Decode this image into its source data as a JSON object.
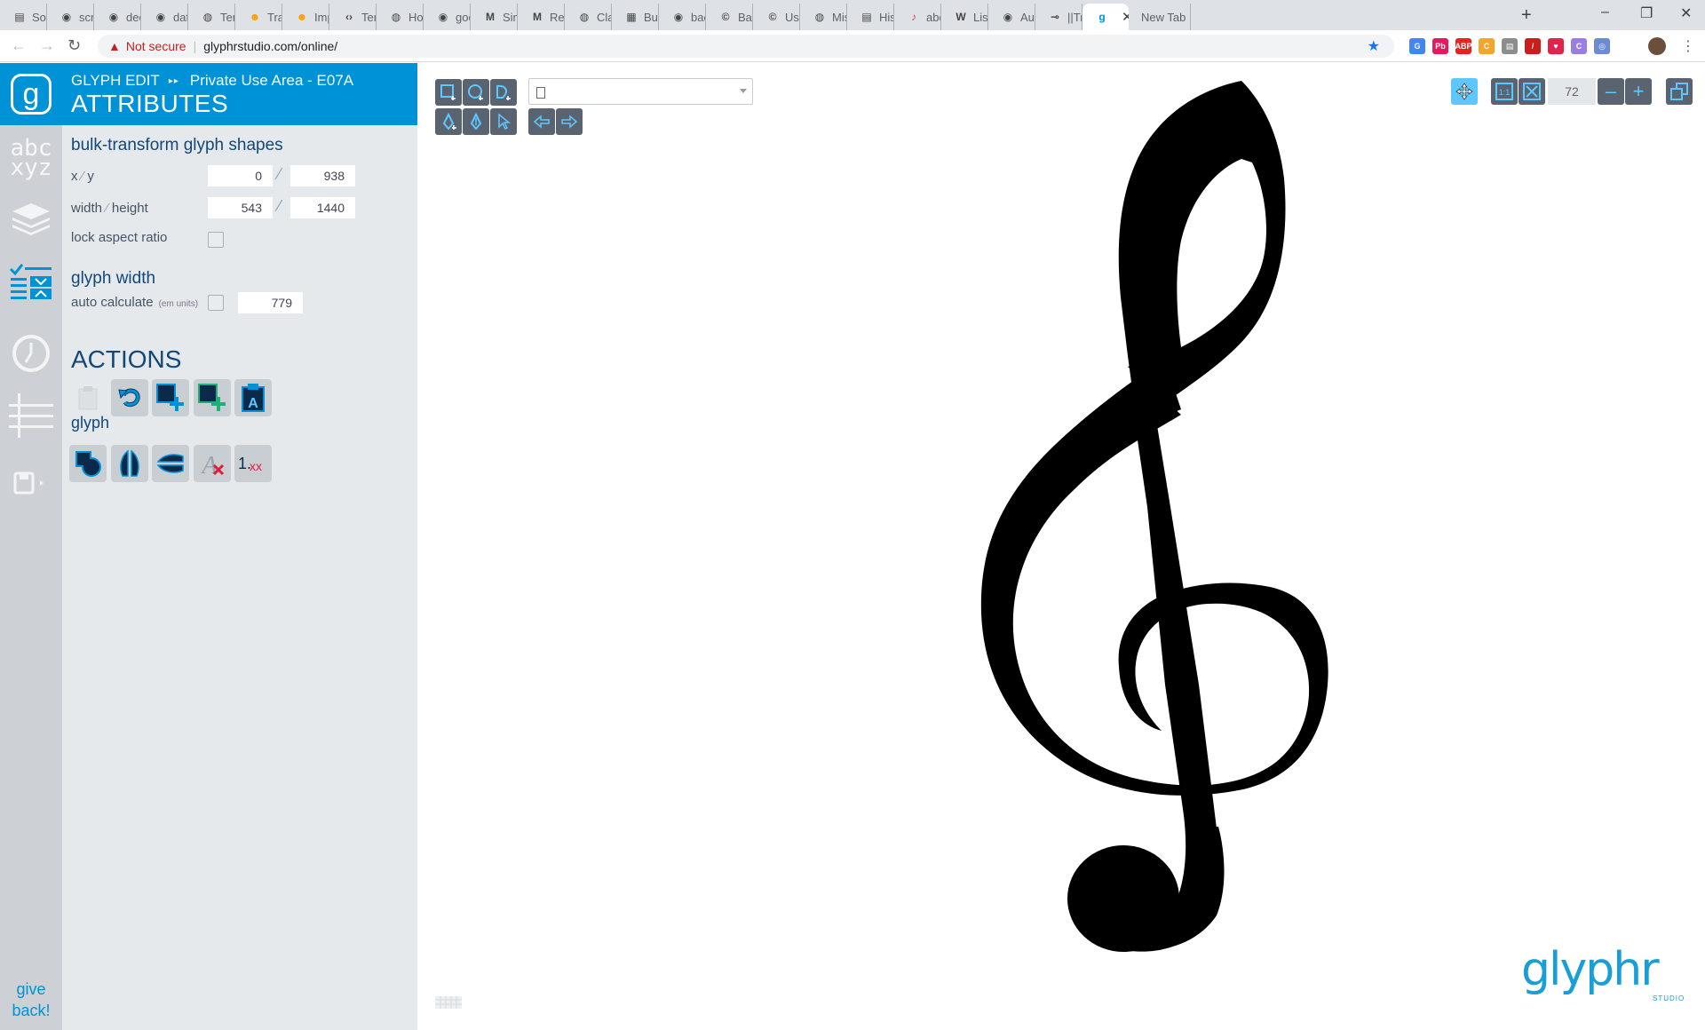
{
  "browser": {
    "tabs": [
      {
        "title": "Solid",
        "icon": "document-icon"
      },
      {
        "title": "scrap",
        "icon": "github-icon"
      },
      {
        "title": "deep",
        "icon": "github-icon"
      },
      {
        "title": "data-",
        "icon": "github-icon"
      },
      {
        "title": "Tenso",
        "icon": "globe-icon"
      },
      {
        "title": "Trans",
        "icon": "hugging-face-icon"
      },
      {
        "title": "Impo",
        "icon": "hugging-face-icon"
      },
      {
        "title": "Tenso",
        "icon": "code-icon"
      },
      {
        "title": "How",
        "icon": "globe-icon"
      },
      {
        "title": "goog",
        "icon": "github-icon"
      },
      {
        "title": "Simp",
        "icon": "medium-icon"
      },
      {
        "title": "Realt",
        "icon": "medium-icon"
      },
      {
        "title": "Class",
        "icon": "globe-icon"
      },
      {
        "title": "Build",
        "icon": "film-icon"
      },
      {
        "title": "bacti",
        "icon": "github-icon"
      },
      {
        "title": "Basic",
        "icon": "circle-c-icon"
      },
      {
        "title": "Using",
        "icon": "circle-c-icon"
      },
      {
        "title": "Misc",
        "icon": "globe-icon"
      },
      {
        "title": "Histo",
        "icon": "document-icon"
      },
      {
        "title": "abcjs",
        "icon": "abcjs-icon"
      },
      {
        "title": "List o",
        "icon": "wikipedia-icon"
      },
      {
        "title": "Audi",
        "icon": "github-icon"
      },
      {
        "title": "||Trac",
        "icon": "track-icon"
      },
      {
        "title": "<",
        "icon": "glyphr-icon",
        "active": true
      },
      {
        "title": "New Tab",
        "icon": ""
      }
    ],
    "new_tab": "+",
    "window_controls": [
      "–",
      "❐",
      "✕"
    ],
    "address": {
      "security_label": "Not secure",
      "url": "glyphrstudio.com/online/"
    },
    "extensions": [
      {
        "label": "G",
        "color": "#4285f4"
      },
      {
        "label": "Pb",
        "color": "#e5195f"
      },
      {
        "label": "ABP",
        "color": "#e6231f"
      },
      {
        "label": "C",
        "color": "#f4a62a"
      },
      {
        "label": "▤",
        "color": "#8d8d8d"
      },
      {
        "label": "/",
        "color": "#cc1d1d"
      },
      {
        "label": "♥",
        "color": "#e0244b"
      },
      {
        "label": "C",
        "color": "#9a7fe3"
      },
      {
        "label": "◎",
        "color": "#6b8bd6"
      }
    ]
  },
  "app": {
    "breadcrumb": {
      "section": "GLYPH EDIT",
      "location": "Private Use Area - E07A"
    },
    "panel_title": "ATTRIBUTES",
    "bulk_transform": {
      "title": "bulk-transform glyph shapes",
      "xy_label": "x",
      "xy_label2": "y",
      "x": "0",
      "y": "938",
      "wh_label": "width",
      "wh_label2": "height",
      "width": "543",
      "height": "1440",
      "lock_label": "lock aspect ratio"
    },
    "glyph_width": {
      "title": "glyph width",
      "auto_label": "auto calculate",
      "auto_note": "(em units)",
      "value": "779"
    },
    "actions_title": "ACTIONS",
    "glyph_section_title": "glyph",
    "give_back": "give back!",
    "zoom": "72",
    "brand": "glyphr",
    "brand_sub": "STUDIO",
    "colors": {
      "accent": "#0092d6",
      "panel": "#e6e9ec",
      "nav": "#cdd1d5",
      "heading": "#11487a"
    }
  }
}
